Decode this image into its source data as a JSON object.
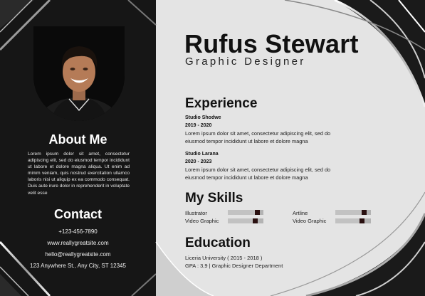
{
  "header": {
    "name": "Rufus Stewart",
    "title": "Graphic Designer"
  },
  "about": {
    "title": "About Me",
    "text": "Lorem ipsum dolor sit amet, consectetur adipiscing elit, sed do eiusmod tempor incididunt ut labore et dolore magna aliqua. Ut enim ad minim veniam, quis nostrud exercitation ullamco laboris nisi ut aliquip ex ea commodo consequat. Duis aute irure dolor in reprehenderit in voluptate velit esse"
  },
  "contact": {
    "title": "Contact",
    "phone": "+123-456-7890",
    "website": "www.reallygreatsite.com",
    "email": "hello@reallygreatsite.com",
    "address": "123 Anywhere St., Any City, ST 12345"
  },
  "experience": {
    "title": "Experience",
    "jobs": [
      {
        "company": "Studio Shodwe",
        "years": "2019 - 2020",
        "desc": "Lorem ipsum dolor sit amet, consectetur adipiscing elit, sed do eiusmod tempor incididunt ut labore et dolore magna"
      },
      {
        "company": "Studio Larana",
        "years": "2020 - 2023",
        "desc": "Lorem ipsum dolor sit amet, consectetur adipiscing elit, sed do eiusmod tempor incididunt ut labore et dolore magna"
      }
    ]
  },
  "skills": {
    "title": "My Skills",
    "items": [
      {
        "name": "Illustrator",
        "level": 0.9
      },
      {
        "name": "Video Graphic",
        "level": 0.84
      },
      {
        "name": "Artline",
        "level": 0.88
      },
      {
        "name": "Video Graphic",
        "level": 0.82
      }
    ]
  },
  "education": {
    "title": "Education",
    "school": "Liceria University ( 2015 - 2018 )",
    "detail": "GPA : 3,9 | Graphic Designer Department"
  },
  "colors": {
    "dark_panel": "#161616",
    "light_panel": "#e4e4e4",
    "skill_knob": "#2a1010"
  }
}
